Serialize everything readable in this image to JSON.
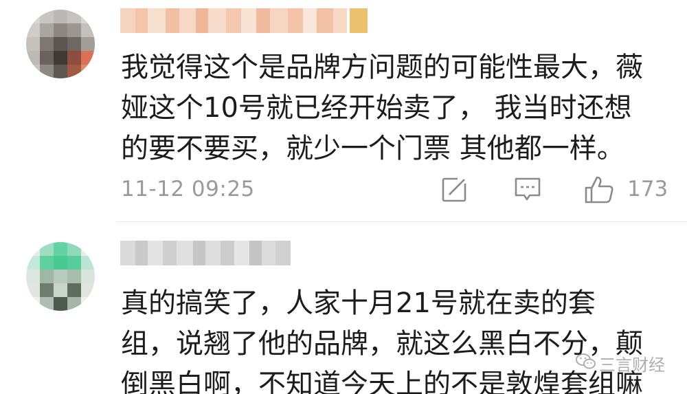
{
  "comments": [
    {
      "username": "",
      "lines": [
        "我觉得这个是品牌方问题的可能性最大，薇",
        "娅这个10号就已经开始卖了， 我当时还想",
        "的要不要买，就少一个门票 其他都一样。"
      ],
      "timestamp": "11-12 09:25",
      "likes": "173"
    },
    {
      "username": "",
      "lines": [
        "真的搞笑了，人家十月21号就在卖的套",
        "组，说翘了他的品牌，就这么黑白不分，颠",
        "倒黑白啊，不知道今天上的不是敦煌套组嘛"
      ]
    }
  ],
  "icons": {
    "share": "share-icon",
    "comment": "comment-icon",
    "like": "thumbs-up-icon",
    "watermark": "wechat-icon"
  },
  "watermark": {
    "text": "三言财经"
  },
  "colors": {
    "text": "#1c1c1c",
    "meta": "#9a9a9a",
    "divider": "#e6e6e6",
    "background": "#ffffff"
  }
}
